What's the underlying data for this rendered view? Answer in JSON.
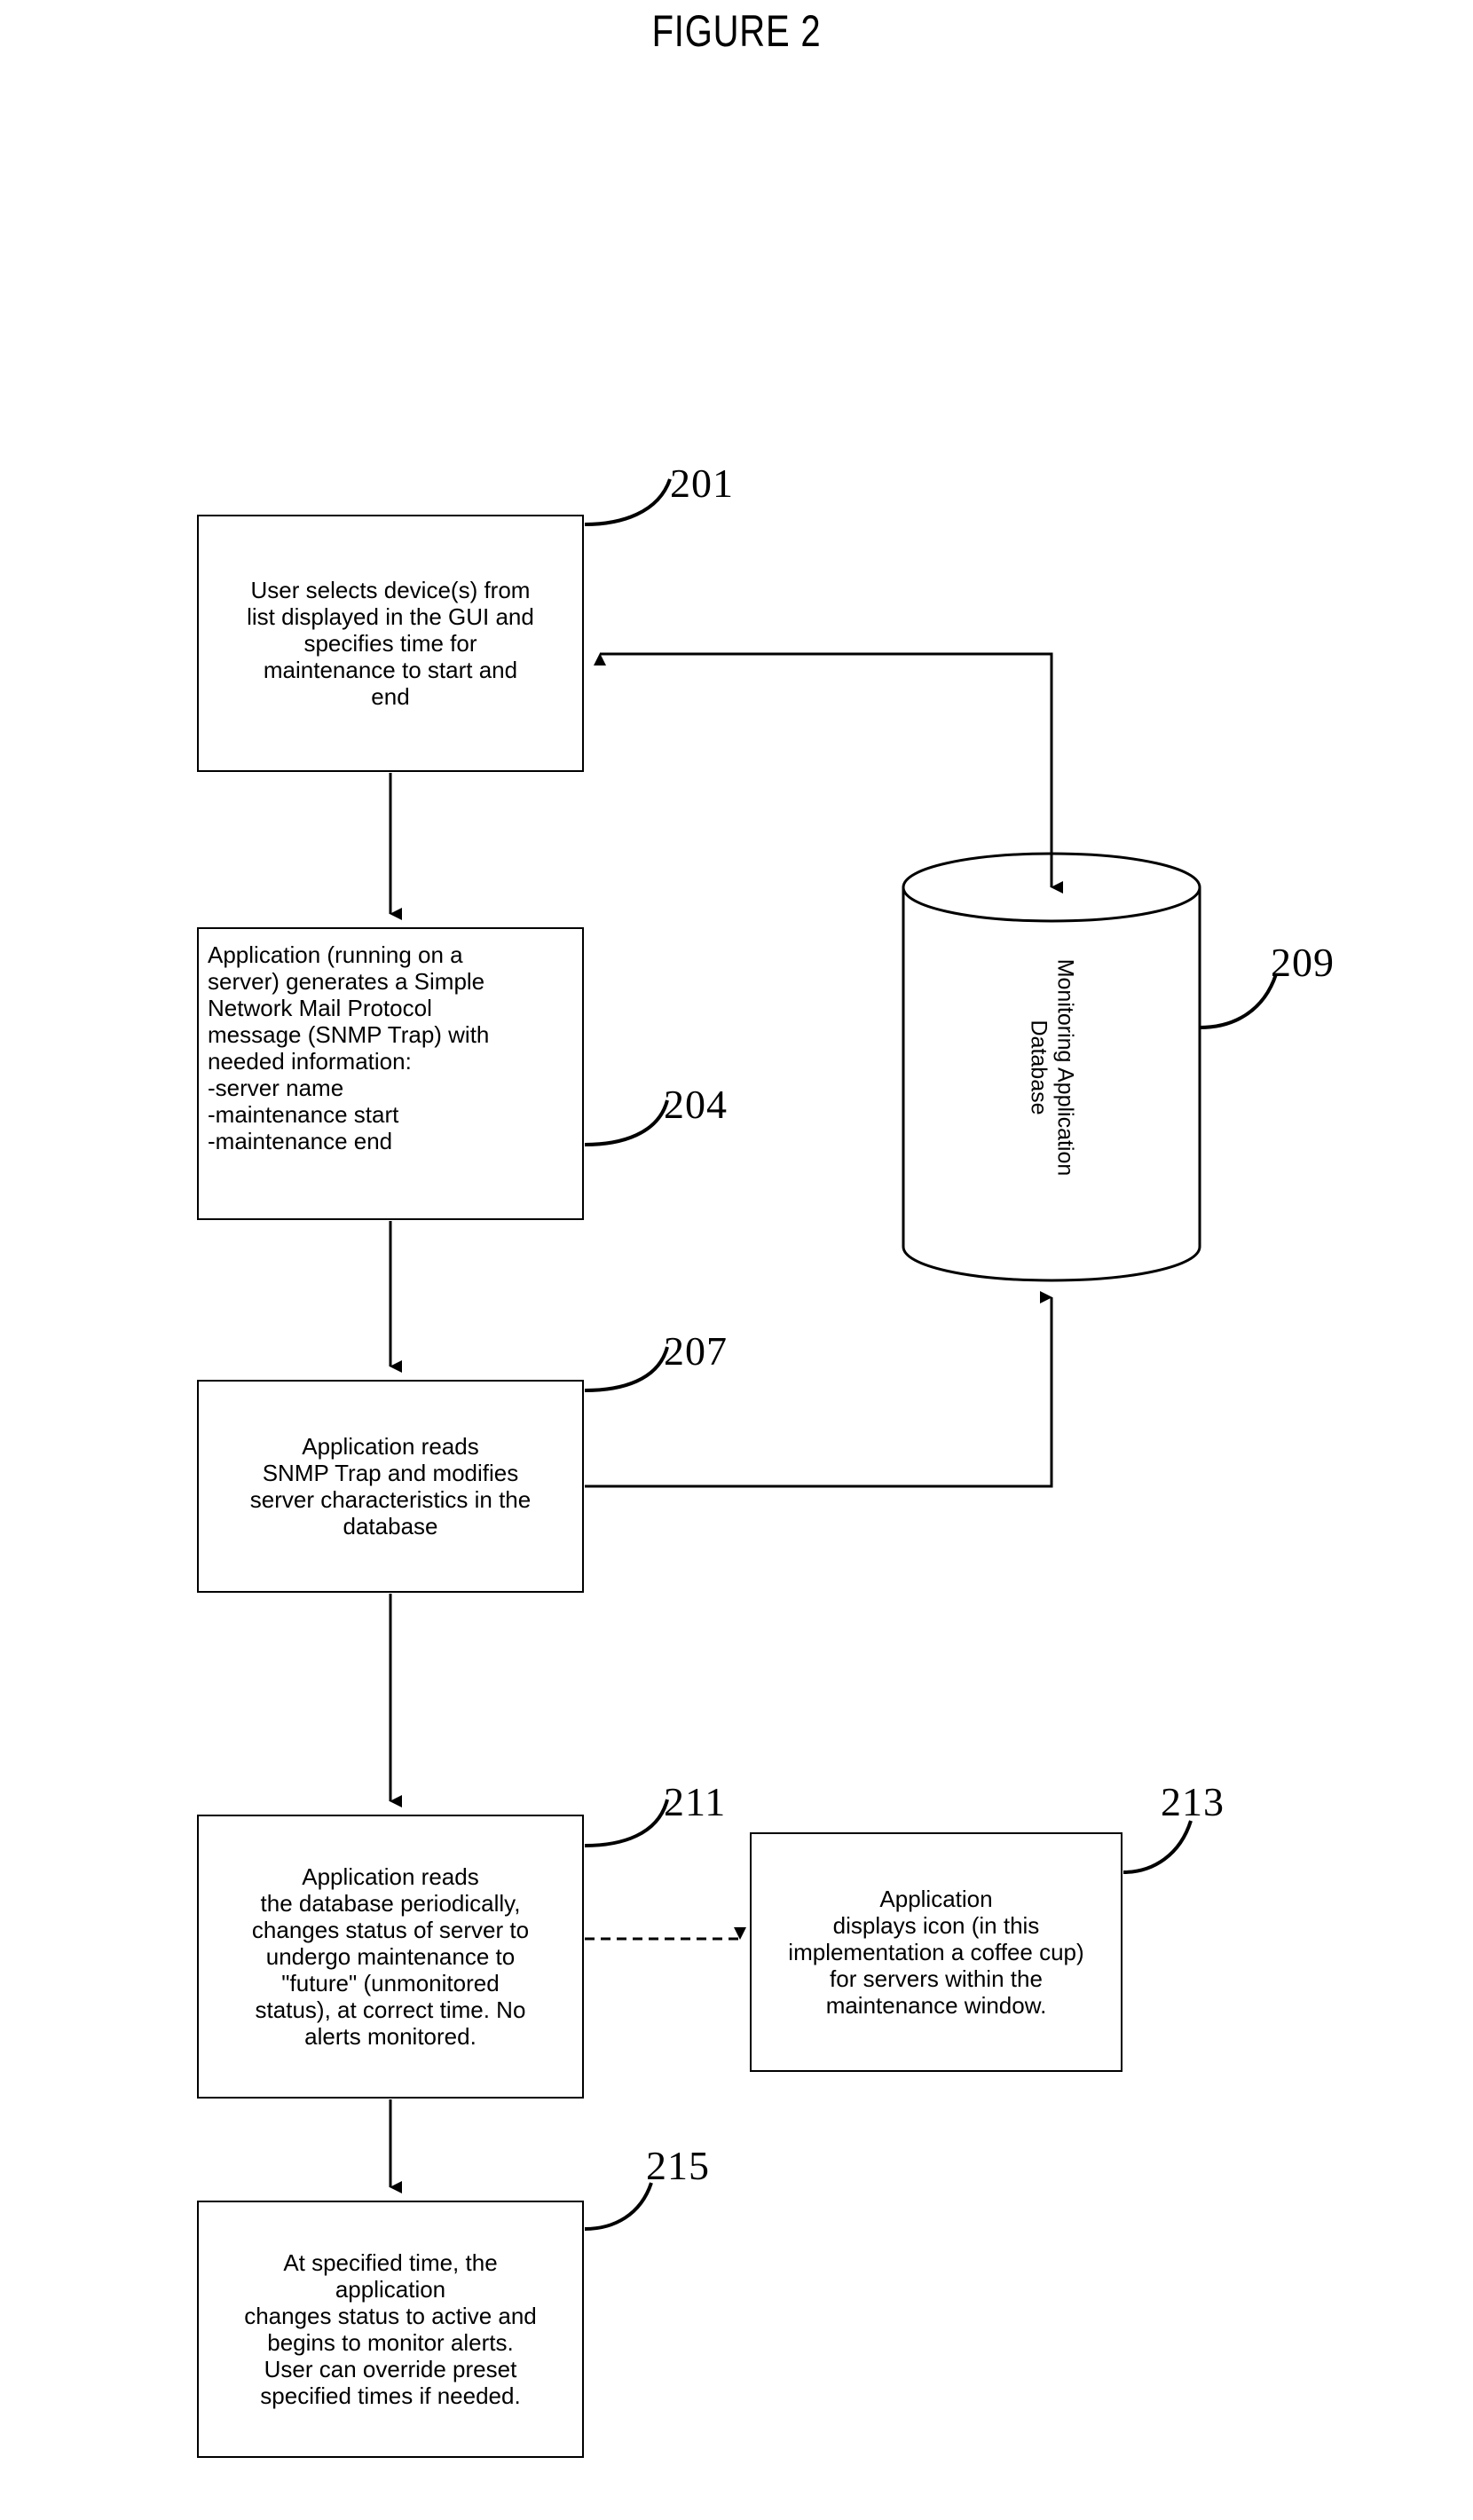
{
  "figure": {
    "title": "FIGURE 2",
    "ink_color": "#000000",
    "background_color": "#ffffff"
  },
  "boxes": {
    "b201": {
      "ref": "201",
      "text": "User selects device(s) from\nlist displayed in the GUI and\nspecifies time for\nmaintenance to start and\nend",
      "align": "center"
    },
    "b204": {
      "ref": "204",
      "text": "Application (running on a\nserver) generates a Simple\nNetwork Mail Protocol\nmessage (SNMP Trap) with\nneeded information:\n-server name\n-maintenance start\n-maintenance end",
      "align": "left"
    },
    "b207": {
      "ref": "207",
      "text": "Application reads\nSNMP Trap and modifies\nserver characteristics in the\ndatabase",
      "align": "center"
    },
    "b211": {
      "ref": "211",
      "text": "Application reads\nthe database periodically,\nchanges status of server to\nundergo maintenance to\n\"future\" (unmonitored\nstatus), at correct time. No\nalerts monitored.",
      "align": "center"
    },
    "b213": {
      "ref": "213",
      "text": "Application\ndisplays icon  (in this\nimplementation a coffee cup)\nfor servers within the\nmaintenance window.",
      "align": "center"
    },
    "b215": {
      "ref": "215",
      "text": "At specified time, the\napplication\nchanges status to active and\nbegins to monitor alerts.\nUser can override preset\nspecified times if needed.",
      "align": "center"
    }
  },
  "database": {
    "ref": "209",
    "label": "Monitoring Application\nDatabase",
    "shape": "cylinder"
  },
  "connectors": [
    {
      "name": "box-201-to-box-204",
      "from": "201",
      "to": "204",
      "style": "solid-arrow",
      "direction": "down"
    },
    {
      "name": "box-204-to-box-207",
      "from": "204",
      "to": "207",
      "style": "solid-arrow",
      "direction": "down"
    },
    {
      "name": "box-207-to-box-211",
      "from": "207",
      "to": "211",
      "style": "solid-arrow",
      "direction": "down"
    },
    {
      "name": "box-211-to-box-215",
      "from": "211",
      "to": "215",
      "style": "solid-arrow",
      "direction": "down"
    },
    {
      "name": "box-211-to-box-213",
      "from": "211",
      "to": "213",
      "style": "dashed-arrow",
      "direction": "right"
    },
    {
      "name": "box-207-to-database",
      "from": "207",
      "to": "209",
      "style": "solid-arrow",
      "direction": "up"
    },
    {
      "name": "database-to-box-201",
      "from": "209",
      "to": "201",
      "style": "solid-arrow",
      "direction": "left"
    }
  ]
}
